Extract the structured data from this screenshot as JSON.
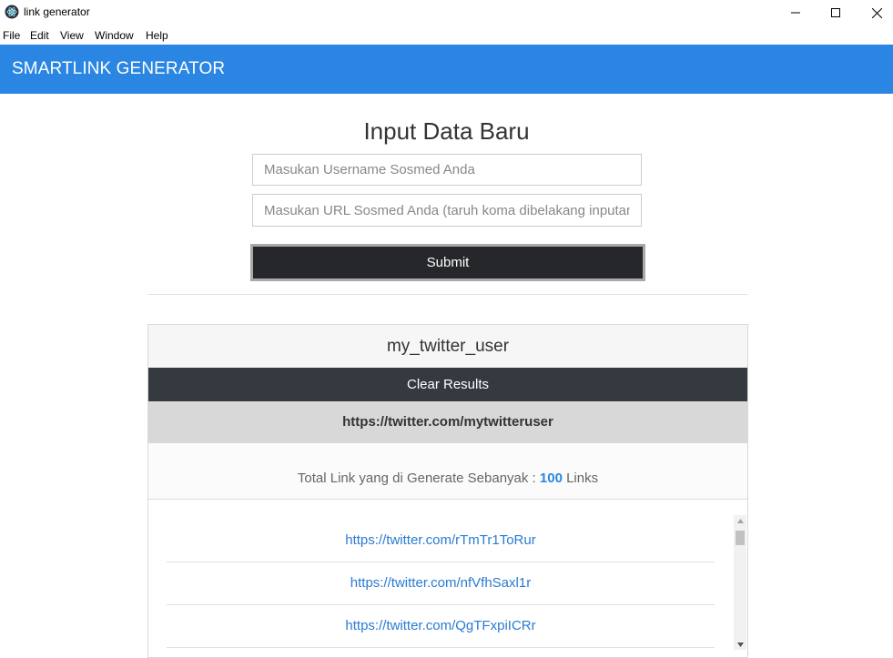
{
  "window": {
    "title": "link generator",
    "menu": [
      "File",
      "Edit",
      "View",
      "Window",
      "Help"
    ]
  },
  "header": {
    "brand": "SMARTLINK GENERATOR"
  },
  "form": {
    "title": "Input Data Baru",
    "username_placeholder": "Masukan Username Sosmed Anda",
    "url_placeholder": "Masukan URL Sosmed Anda (taruh koma dibelakang inputan",
    "username_value": "",
    "url_value": "",
    "submit_label": "Submit"
  },
  "result": {
    "username": "my_twitter_user",
    "clear_label": "Clear Results",
    "source_url": "https://twitter.com/mytwitteruser",
    "total_prefix": "Total Link yang di Generate Sebanyak :",
    "total_count": "100",
    "total_suffix": "Links",
    "links": [
      "https://twitter.com/rTmTr1ToRur",
      "https://twitter.com/nfVfhSaxl1r",
      "https://twitter.com/QgTFxpiICRr"
    ]
  },
  "colors": {
    "accent": "#2a86e2",
    "dark_button": "#25272a",
    "clear_button": "#343a40",
    "link": "#2a7bd1"
  }
}
